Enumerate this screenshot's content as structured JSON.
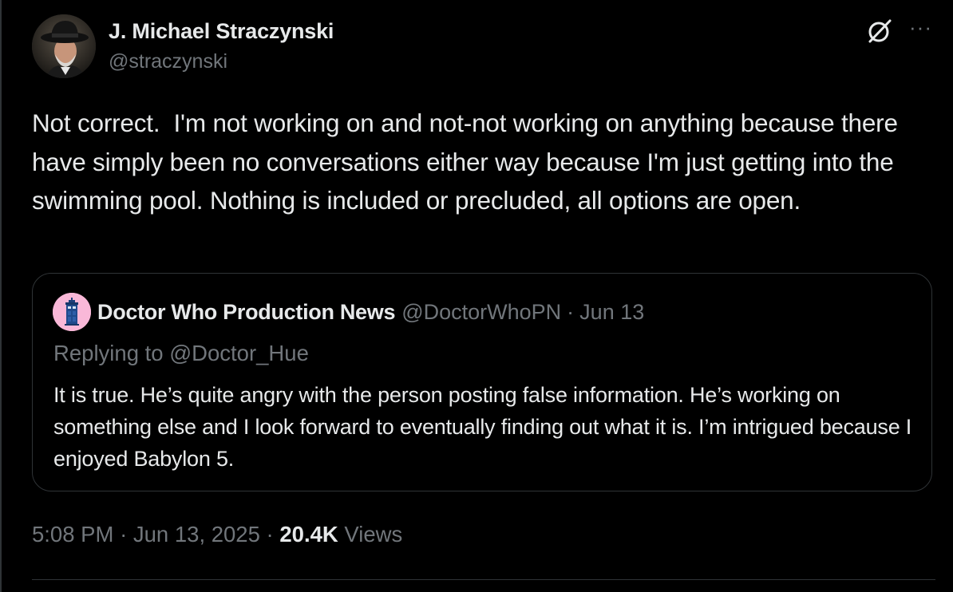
{
  "tweet": {
    "author": {
      "display_name": "J. Michael Straczynski",
      "handle": "@straczynski",
      "avatar_icon": "profile-photo-avatar"
    },
    "actions": {
      "grok_icon": "grok-slash-circle-icon",
      "more_label": "···"
    },
    "text": "Not correct.  I'm not working on and not-not working on anything because there have simply been no conversations either way because I'm just getting into the swimming pool. Nothing is included or precluded, all options are open.",
    "quoted": {
      "display_name": "Doctor Who Production News",
      "handle": "@DoctorWhoPN",
      "separator": "·",
      "date": "Jun 13",
      "avatar_icon": "tardis-icon",
      "avatar_bg": "#f9b8d8",
      "replying_to": "Replying to @Doctor_Hue",
      "text": "It is true. He’s quite angry with the person posting false information. He’s working on something else and I look forward to eventually finding out what it is. I’m intrigued because I enjoyed Babylon 5."
    },
    "meta": {
      "time": "5:08 PM",
      "separator": "·",
      "date": "Jun 13, 2025",
      "views_count": "20.4K",
      "views_label": "Views"
    }
  },
  "colors": {
    "background": "#000000",
    "primary_text": "#e7e9ea",
    "secondary_text": "#71767b",
    "border": "#2f3336"
  }
}
